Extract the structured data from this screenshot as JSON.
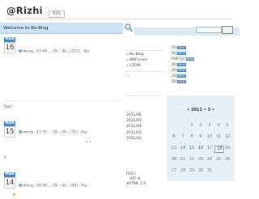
{
  "header": {
    "title": "@Rizhi",
    "nav_tag": "RSS"
  },
  "welcome": "Welcome to Bo-Blog",
  "posts": [
    {
      "month": "MAR",
      "day": "16",
      "meta": "meng , 23:04 ,   ,  (0) ,  (0) ,  (215) ,  Via"
    },
    {
      "month": "MAR",
      "day": "15",
      "meta": "meng , 12:35 ,   ,  (0) ,  (0) ,  (71) ,  Via"
    },
    {
      "month": "MAR",
      "day": "14",
      "meta": "meng , 00:40 ,   ,  (0) ,  (0) ,  (90) ,  Via"
    }
  ],
  "tags_label": "Tags:",
  "post2_dots": "•  •",
  "post3_marker": "//",
  "links": [
    "» Bo-Blog",
    "» BMForum",
    "» CSDN"
  ],
  "side_dash": "--",
  "tag_list": [
    {
      "text": "[0]",
      "badge": "NEW"
    },
    {
      "text": "[0]",
      "badge": "NEW"
    },
    {
      "text": "PHP [0]",
      "badge": "NEW"
    },
    {
      "text": "[0]",
      "badge": "NEW"
    },
    {
      "text": "[0]",
      "badge": "NEW"
    },
    {
      "text": "[0]",
      "badge": "NEW"
    },
    {
      "text": "[0]",
      "badge": "NEW"
    }
  ],
  "calendar": {
    "title": "« 2011 • 3 »",
    "weeks": [
      [
        "",
        "",
        "1",
        "2",
        "3",
        "4",
        "5"
      ],
      [
        "6",
        "7",
        "8",
        "9",
        "10",
        "11",
        "12"
      ],
      [
        "13",
        "14",
        "15",
        "16",
        "17",
        "18",
        "19"
      ],
      [
        "20",
        "21",
        "22",
        "23",
        "24",
        "25",
        "26"
      ],
      [
        "27",
        "28",
        "29",
        "30",
        "31",
        "",
        ""
      ]
    ],
    "links": [
      "6",
      "12",
      "14",
      "15",
      "16",
      "20"
    ],
    "today": "18"
  },
  "archives": [
    "2011/06",
    "2011/05",
    "2011/04",
    "2011/03",
    "2011/02"
  ],
  "footer": {
    "rss": "RSS",
    "bar": "|",
    "charset": "UTF-8",
    "xhtml": "XHTML 1.0"
  }
}
